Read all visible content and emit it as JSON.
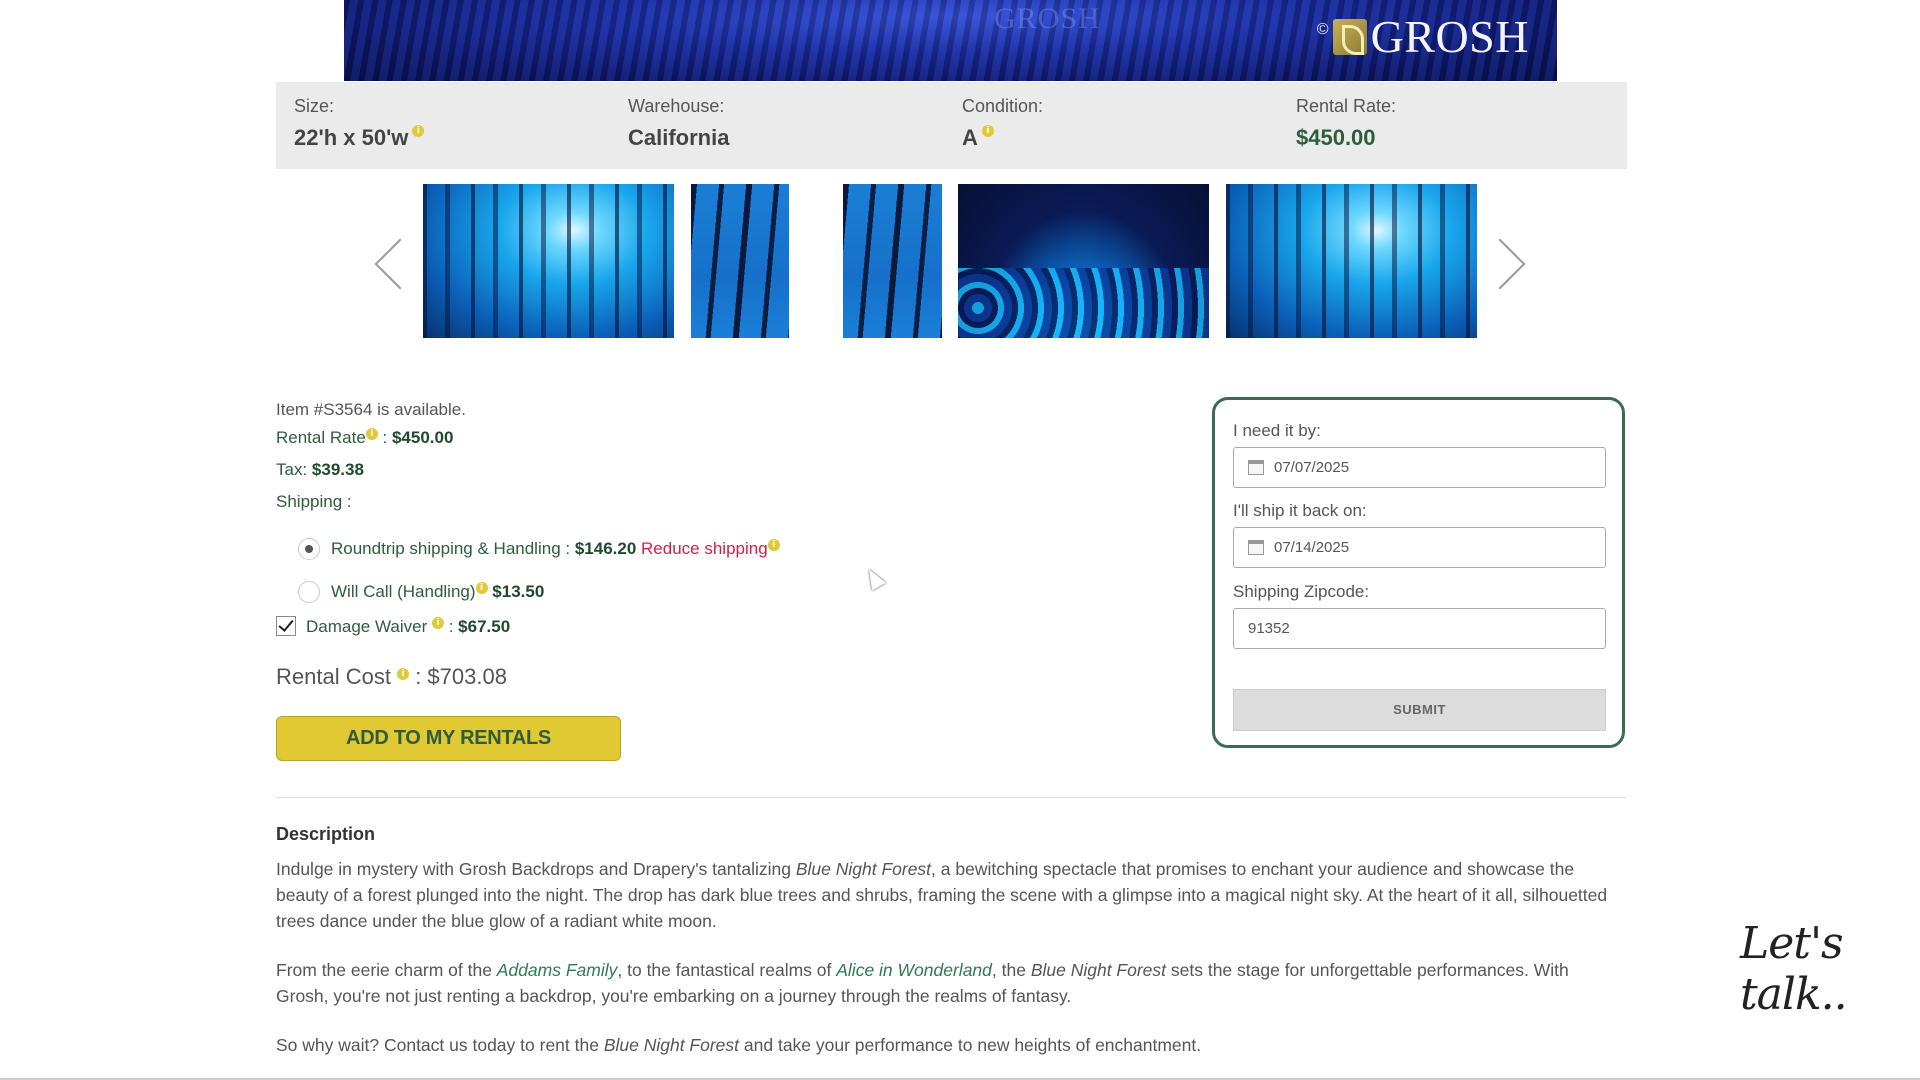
{
  "hero": {
    "watermark": "GROSH",
    "copyright": "©",
    "brand": "GROSH"
  },
  "specs": {
    "size_label": "Size:",
    "size_value": "22'h x 50'w",
    "warehouse_label": "Warehouse:",
    "warehouse_value": "California",
    "condition_label": "Condition:",
    "condition_value": "A",
    "rate_label": "Rental Rate:",
    "rate_value": "$450.00"
  },
  "info_icon": "i",
  "availability": {
    "status": "Item #S3564 is available.",
    "rental_rate_label": "Rental Rate",
    "rental_rate_value": "$450.00",
    "tax_label": "Tax:",
    "tax_value": "$39.38",
    "shipping_label": "Shipping :",
    "roundtrip_label": "Roundtrip shipping & Handling :",
    "roundtrip_value": "$146.20",
    "reduce_shipping": "Reduce shipping",
    "willcall_label": "Will Call (Handling)",
    "willcall_value": "$13.50",
    "waiver_label": "Damage Waiver",
    "waiver_value": "$67.50",
    "rental_cost_label": "Rental Cost",
    "rental_cost_value": "$703.08",
    "add_button": "ADD TO MY RENTALS",
    "shipping_selected": "roundtrip",
    "damage_waiver_checked": true
  },
  "form": {
    "need_by_label": "I need it by:",
    "need_by_value": "07/07/2025",
    "ship_back_label": "I'll ship it back on:",
    "ship_back_value": "07/14/2025",
    "zip_label": "Shipping Zipcode:",
    "zip_value": "91352",
    "submit": "SUBMIT"
  },
  "description": {
    "title": "Description",
    "p1_a": "Indulge in mystery with Grosh Backdrops and Drapery's tantalizing ",
    "p1_em": "Blue Night Forest",
    "p1_b": ", a bewitching spectacle that promises to enchant your audience and showcase the beauty of a forest plunged into the night. The drop has dark blue trees and shrubs, framing the scene with a glimpse into a magical night sky. At the heart of it all, silhouetted trees dance under the blue glow of a radiant white moon.",
    "p2_a": "From the eerie charm of the ",
    "p2_link1": "Addams Family",
    "p2_b": ", to the fantastical realms of ",
    "p2_link2": "Alice in Wonderland",
    "p2_c": ", the ",
    "p2_em": "Blue Night Forest",
    "p2_d": " sets the stage for unforgettable performances. With Grosh, you're not just renting a backdrop, you're embarking on a journey through the realms of fantasy.",
    "p3_a": "So why wait? Contact us today to rent the ",
    "p3_em": "Blue Night Forest",
    "p3_b": " and take your performance to new heights of enchantment."
  },
  "chat": {
    "label": "Let's talk.."
  },
  "colors": {
    "accent_green": "#2e5c3c",
    "button_yellow": "#e0c933",
    "reduce_red": "#d0204a",
    "info_yellow": "#e2c93a"
  },
  "icons": [
    "calendar-icon",
    "info-icon",
    "chevron-left-icon",
    "chevron-right-icon"
  ]
}
